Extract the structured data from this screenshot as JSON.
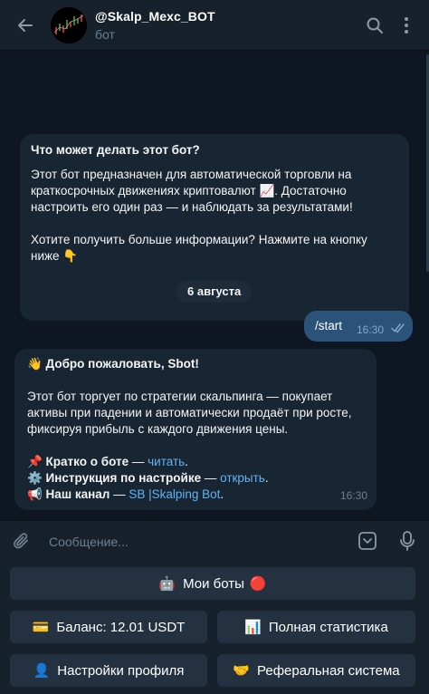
{
  "header": {
    "title": "@Skalp_Mexc_BOT",
    "subtitle": "бот"
  },
  "bot_info": {
    "title": "Что может делать этот бот?",
    "paragraph1": "Этот бот предназначен для автоматической торговли на краткосрочных движениях криптовалют 📈. Достаточно настроить его один раз — и наблюдать за результатами!",
    "paragraph2": "Хотите получить больше информации? Нажмите на кнопку ниже 👇"
  },
  "date_badge": "6 августа",
  "outgoing_message": {
    "text": "/start",
    "time": "16:30"
  },
  "welcome_message": {
    "greeting": "👋 Добро пожаловать, Sbot!",
    "body": "Этот бот торгует по стратегии скальпинга — покупает активы при падении и автоматически продаёт при росте, фиксируя прибыль с каждого движения цены.",
    "line1_label": "📌 Кратко о боте",
    "line1_sep": " — ",
    "line1_link": "читать",
    "line1_end": ".",
    "line2_label": "⚙️ Инструкция по настройке",
    "line2_sep": " — ",
    "line2_link": "открыть",
    "line2_end": ".",
    "line3_label": "📢 Наш канал",
    "line3_sep": " — ",
    "line3_link": "SB |Skalping Bot",
    "line3_end": ".",
    "time": "16:30"
  },
  "input": {
    "placeholder": "Сообщение..."
  },
  "keyboard": {
    "my_bots": {
      "emoji": "🤖",
      "label": "Мои боты",
      "badge": "🔴"
    },
    "balance": {
      "emoji": "💳",
      "label": "Баланс: 12.01 USDT"
    },
    "stats": {
      "emoji": "📊",
      "label": "Полная статистика"
    },
    "profile": {
      "emoji": "👤",
      "label": "Настройки профиля"
    },
    "referral": {
      "emoji": "🤝",
      "label": "Реферальная система"
    }
  },
  "colors": {
    "background": "#0e1621",
    "header": "#17212b",
    "bubble_in": "#182533",
    "bubble_out": "#2b5278",
    "link": "#62b3f0",
    "button": "#243140"
  },
  "icons": {
    "back": "arrow-left-icon",
    "search": "search-icon",
    "more": "more-vertical-icon",
    "attach": "paperclip-icon",
    "keyboard": "bot-keyboard-icon",
    "mic": "microphone-icon",
    "read": "double-check-icon"
  }
}
